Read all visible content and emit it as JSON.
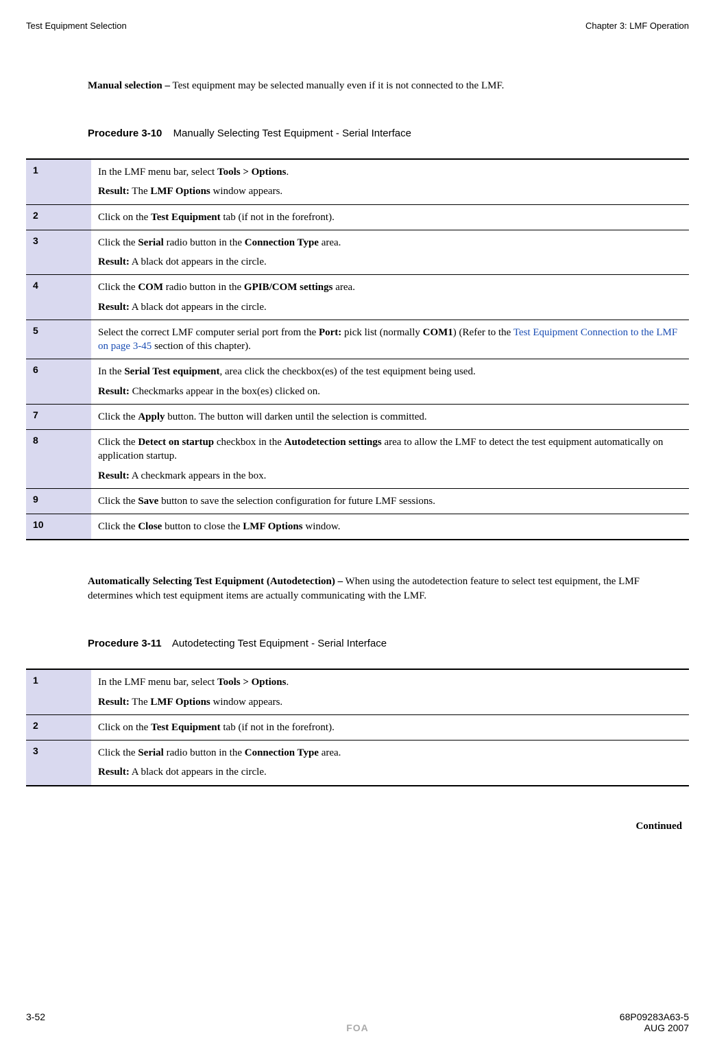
{
  "header": {
    "left": "Test Equipment Selection",
    "right": "Chapter 3: LMF Operation"
  },
  "manual_selection": {
    "bold": "Manual selection –",
    "text": " Test equipment may be selected manually even if it is not connected to the LMF."
  },
  "procedure310": {
    "num": "Procedure 3-10",
    "title": "Manually Selecting Test Equipment - Serial Interface",
    "steps": [
      {
        "n": "1",
        "p1a": "In the LMF menu bar, select ",
        "p1b": "Tools > Options",
        "p1c": ".",
        "p2a": "Result:",
        "p2b": " The ",
        "p2c": "LMF Options",
        "p2d": " window appears."
      },
      {
        "n": "2",
        "p1a": "Click on the ",
        "p1b": "Test Equipment",
        "p1c": " tab (if not in the forefront)."
      },
      {
        "n": "3",
        "p1a": "Click the ",
        "p1b": "Serial",
        "p1c": " radio button in the ",
        "p1d": "Connection Type",
        "p1e": " area.",
        "p2a": "Result:",
        "p2b": " A black dot appears in the circle."
      },
      {
        "n": "4",
        "p1a": "Click the ",
        "p1b": "COM",
        "p1c": " radio button in the ",
        "p1d": "GPIB/COM settings",
        "p1e": " area.",
        "p2a": "Result:",
        "p2b": " A black dot appears in the circle."
      },
      {
        "n": "5",
        "p1a": "Select the correct LMF computer serial port from the ",
        "p1b": "Port:",
        "p1c": " pick list (normally ",
        "p1d": "COM1",
        "p1e": ") (Refer to the ",
        "p1link": "Test Equipment Connection to the LMF on page 3-45",
        "p1f": " section of this chapter)."
      },
      {
        "n": "6",
        "p1a": "In the ",
        "p1b": "Serial Test equipment",
        "p1c": ", area click the checkbox(es) of the test equipment being used.",
        "p2a": "Result:",
        "p2b": " Checkmarks appear in the box(es) clicked on."
      },
      {
        "n": "7",
        "p1a": "Click the ",
        "p1b": "Apply",
        "p1c": " button. The button will darken until the selection is committed."
      },
      {
        "n": "8",
        "p1a": "Click the ",
        "p1b": "Detect on startup",
        "p1c": " checkbox in the ",
        "p1d": "Autodetection settings",
        "p1e": " area to allow the LMF to detect the test equipment automatically on application startup.",
        "p2a": "Result:",
        "p2b": " A checkmark appears in the box."
      },
      {
        "n": "9",
        "p1a": "Click the ",
        "p1b": "Save",
        "p1c": " button to save the selection configuration for future LMF sessions."
      },
      {
        "n": "10",
        "p1a": "Click the ",
        "p1b": "Close",
        "p1c": " button to close the ",
        "p1d": "LMF Options",
        "p1e": " window."
      }
    ]
  },
  "auto_selection": {
    "bold": "Automatically Selecting Test Equipment (Autodetection) –",
    "text": " When using the autodetection feature to select test equipment, the LMF determines which test equipment items are actually communicating with the LMF."
  },
  "procedure311": {
    "num": "Procedure 3-11",
    "title": "Autodetecting Test Equipment - Serial Interface",
    "steps": [
      {
        "n": "1",
        "p1a": "In the LMF menu bar, select ",
        "p1b": "Tools > Options",
        "p1c": ".",
        "p2a": "Result:",
        "p2b": " The ",
        "p2c": "LMF Options",
        "p2d": " window appears."
      },
      {
        "n": "2",
        "p1a": "Click on the ",
        "p1b": "Test Equipment",
        "p1c": " tab (if not in the forefront)."
      },
      {
        "n": "3",
        "p1a": "Click the ",
        "p1b": "Serial",
        "p1c": " radio button in the ",
        "p1d": "Connection Type",
        "p1e": " area.",
        "p2a": "Result:",
        "p2b": " A black dot appears in the circle."
      }
    ]
  },
  "continued": "Continued",
  "footer": {
    "page": "3-52",
    "doc": "68P09283A63-5",
    "foa": "FOA",
    "date": "AUG 2007"
  }
}
